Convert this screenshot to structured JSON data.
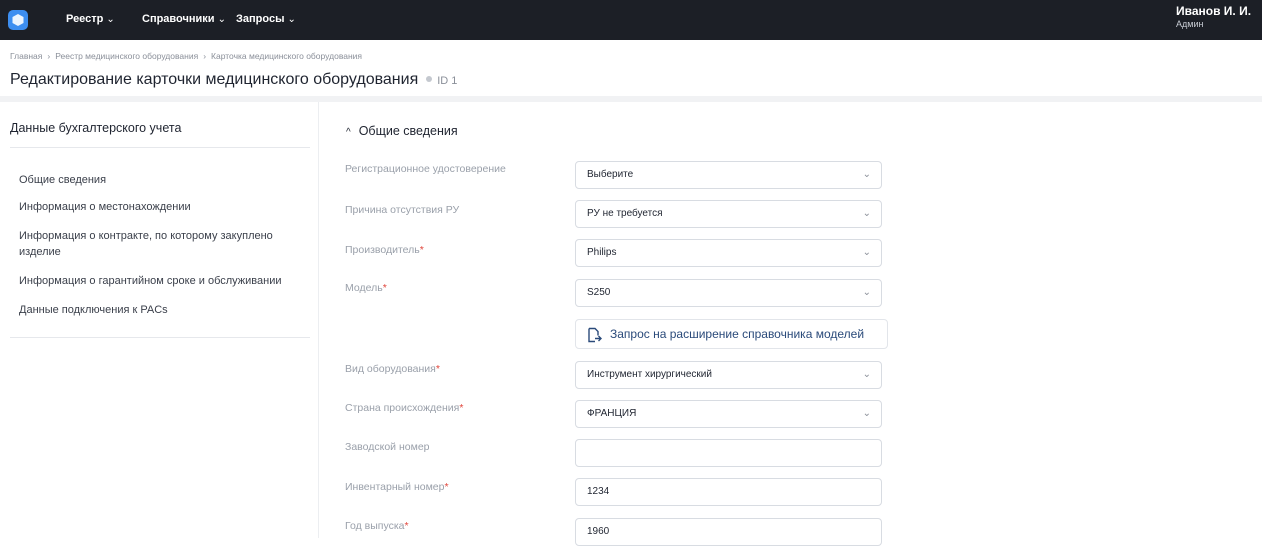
{
  "header": {
    "nav": [
      {
        "label": "Реестр",
        "chevron": "⌄"
      },
      {
        "label": "Справочники",
        "chevron": "⌄"
      },
      {
        "label": "Запросы",
        "chevron": "⌄"
      }
    ],
    "user": {
      "name": "Иванов И. И.",
      "role": "Админ"
    },
    "logo_icon": "hexagon-logo-icon"
  },
  "breadcrumb": [
    "Главная",
    "Реестр медицинского оборудования",
    "Карточка медицинского оборудования"
  ],
  "breadcrumb_separator": "›",
  "page": {
    "title": "Редактирование карточки медицинского оборудования",
    "id": "ID 1"
  },
  "sidebar": {
    "title": "Данные бухгалтерского учета",
    "items": [
      {
        "label": "Общие сведения"
      },
      {
        "label": "Информация о местонахождении"
      },
      {
        "label": "Информация о контракте, по которому закуплено изделие"
      },
      {
        "label": "Информация о гарантийном сроке и обслуживании"
      },
      {
        "label": "Данные подключения к PACs"
      }
    ]
  },
  "section": {
    "caret": "^",
    "title": "Общие сведения"
  },
  "form": {
    "fields": [
      {
        "label": "Регистрационное удостоверение",
        "value": "Выберите",
        "type": "select",
        "required": false
      },
      {
        "label": "Причина отсутствия РУ",
        "value": "РУ не требуется",
        "type": "select",
        "required": false
      },
      {
        "label": "Производитель",
        "value": "Philips",
        "type": "select",
        "required": true
      },
      {
        "label": "Модель",
        "value": "S250",
        "type": "select",
        "required": true
      },
      {
        "label": "Вид оборудования",
        "value": "Инструмент хирургический",
        "type": "select",
        "required": true
      },
      {
        "label": "Страна происхождения",
        "value": "ФРАНЦИЯ",
        "type": "select",
        "required": true
      },
      {
        "label": "Заводской номер",
        "value": "",
        "type": "input",
        "required": false
      },
      {
        "label": "Инвентарный номер",
        "value": "1234",
        "type": "input",
        "required": true
      },
      {
        "label": "Год выпуска",
        "value": "1960",
        "type": "input",
        "required": true
      }
    ],
    "required_mark": "*",
    "select_chevron": "⌄",
    "model_request_button": {
      "label": "Запрос на расширение справочника моделей",
      "icon": "document-export-icon"
    }
  },
  "colors": {
    "topbar": "#1c1f26",
    "accent": "#3d8ef0",
    "required": "#e0443a",
    "link": "#2a4a7a"
  }
}
